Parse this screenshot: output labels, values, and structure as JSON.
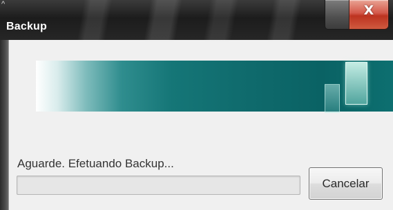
{
  "window": {
    "title": "Backup",
    "system_corner_glyph": "^",
    "close_glyph": "X",
    "icons": {
      "close": "close-icon",
      "minimize": "minimize-icon"
    }
  },
  "content": {
    "status_text": "Aguarde. Efetuando Backup...",
    "progress": 0,
    "cancel_label": "Cancelar"
  },
  "colors": {
    "title_bar": "#262626",
    "close_button": "#c8422d",
    "banner_teal": "#0f6a6c",
    "client_background": "#f0f0f0"
  }
}
